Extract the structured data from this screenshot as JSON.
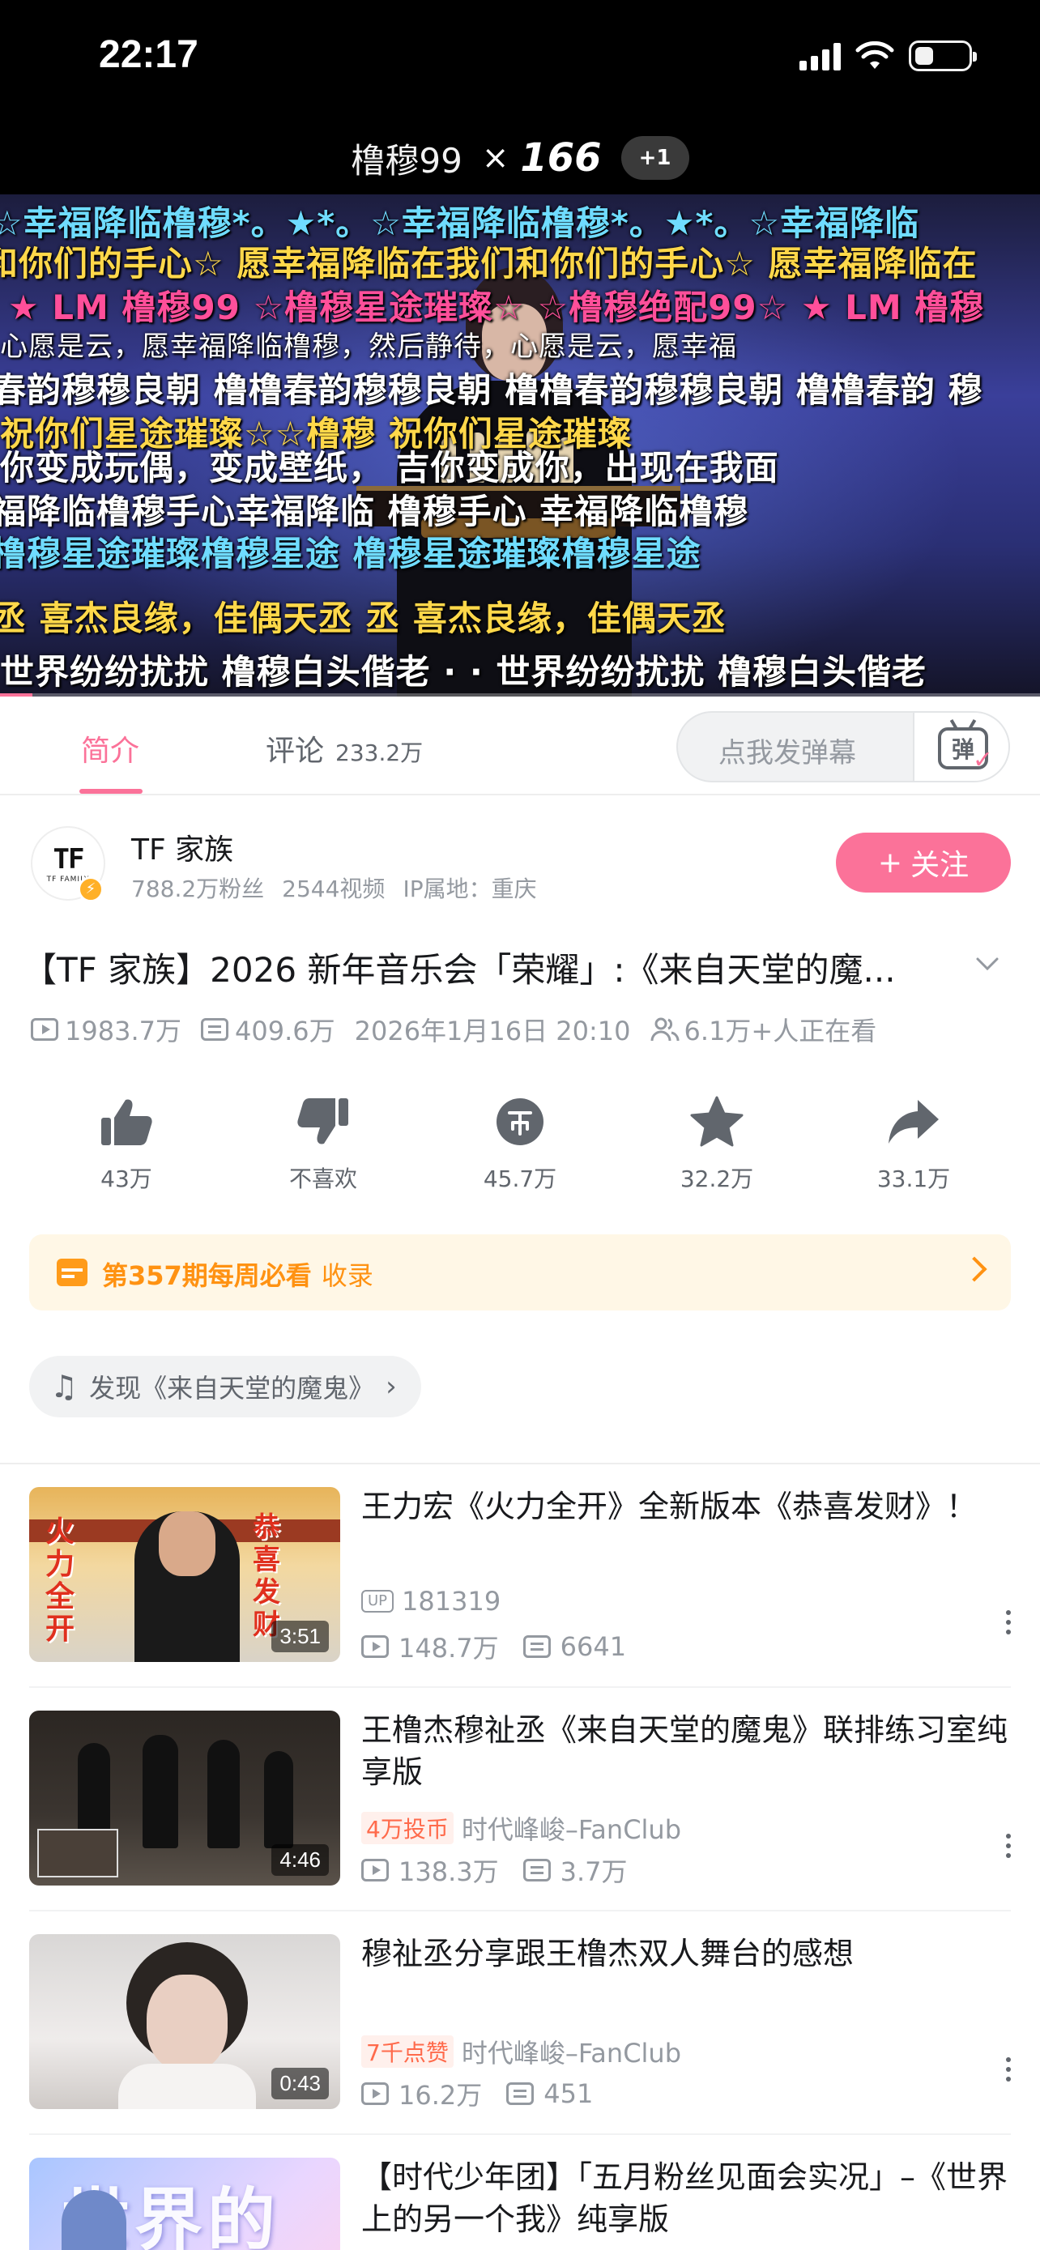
{
  "status_bar": {
    "time": "22:17"
  },
  "video_header": {
    "title": "橹穆99",
    "multiplier": "×",
    "count": "166",
    "badge": "+1"
  },
  "danmaku": [
    "☆幸福降临橹穆*。★*。☆幸福降临橹穆*。★*。☆幸福降临",
    "和你们的手心☆ 愿幸福降临在我们和你们的手心☆ 愿幸福降临在",
    "★ LM 橹穆99 ☆橹穆星途璀璨☆ ☆橹穆绝配99☆ ★ LM 橹穆",
    "心愿是云，愿幸福降临橹穆，然后静待，心愿是云，愿幸福",
    "春韵穆穆良朝 橹橹春韵穆穆良朝 橹橹春韵穆穆良朝 橹橹春韵 穆",
    "祝你们星途璀璨☆☆橹穆  祝你们星途璀璨",
    "你变成玩偶，变成壁纸，  吉你变成你，出现在我面",
    "福降临橹穆手心幸福降临   橹穆手心 幸福降临橹穆",
    "橹穆星途璀璨橹穆星途   橹穆星途璀璨橹穆星途",
    "丞 喜杰良缘，佳偶天丞   丞 喜杰良缘，佳偶天丞",
    "世界纷纷扰扰 橹穆白头偕老 · · 世界纷纷扰扰 橹穆白头偕老"
  ],
  "tabs": {
    "intro": "简介",
    "comments": "评论",
    "comments_count": "233.2万",
    "danmaku_placeholder": "点我发弹幕",
    "danmaku_icon_label": "弹"
  },
  "uploader": {
    "logo": "TF",
    "logo_sub": "TF FAMILY",
    "name": "TF 家族",
    "fans": "788.2万粉丝",
    "videos": "2544视频",
    "ip": "IP属地：重庆",
    "follow_label": "关注",
    "follow_plus": "+"
  },
  "video": {
    "title": "【TF 家族】2026 新年音乐会「荣耀」:《来自天堂的魔...",
    "views": "1983.7万",
    "danmaku_count": "409.6万",
    "date": "2026年1月16日 20:10",
    "watching": "6.1万+人正在看"
  },
  "actions": {
    "like": "43万",
    "dislike": "不喜欢",
    "coin": "45.7万",
    "favorite": "32.2万",
    "share": "33.1万"
  },
  "weekly": {
    "label": "第357期每周必看",
    "action": "收录"
  },
  "music": {
    "label": "发现《来自天堂的魔鬼》"
  },
  "recommendations": [
    {
      "title": "王力宏《火力全开》全新版本《恭喜发财》！",
      "owner_tag": "UP",
      "owner": "181319",
      "views": "148.7万",
      "danmaku": "6641",
      "duration": "3:51",
      "thumb_text_left": "火力全开",
      "thumb_text_right": "恭喜发财"
    },
    {
      "title": "王橹杰穆祉丞《来自天堂的魔鬼》联排练习室纯享版",
      "highlight": "4万投币",
      "owner": "时代峰峻–FanClub",
      "views": "138.3万",
      "danmaku": "3.7万",
      "duration": "4:46"
    },
    {
      "title": "穆祉丞分享跟王橹杰双人舞台的感想",
      "highlight": "7千点赞",
      "owner": "时代峰峻–FanClub",
      "views": "16.2万",
      "danmaku": "451",
      "duration": "0:43"
    },
    {
      "title": "【时代少年团】「五月粉丝见面会实况」–《世界上的另一个我》纯享版",
      "thumb_text": "世界的我"
    }
  ],
  "colors": {
    "accent": "#fb7299",
    "weekly": "#ff9212",
    "muted": "#9499a0"
  }
}
